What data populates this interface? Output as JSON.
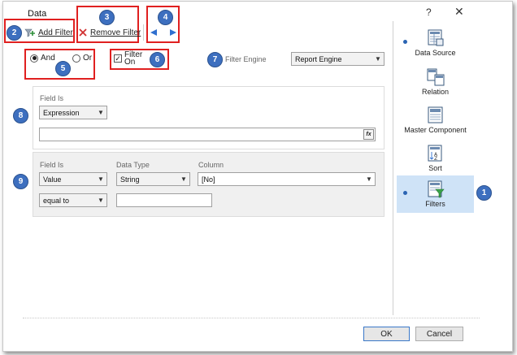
{
  "window": {
    "title": "Data",
    "help": "?",
    "close": "✕"
  },
  "toolbar": {
    "add_filter": "Add Filter",
    "remove_filter": "Remove Filter"
  },
  "callouts": [
    "1",
    "2",
    "3",
    "4",
    "5",
    "6",
    "7",
    "8",
    "9"
  ],
  "logic": {
    "and_label": "And",
    "or_label": "Or",
    "selected": "And"
  },
  "filter_on": {
    "label_line1": "Filter",
    "label_line2": "On",
    "checked": true
  },
  "filter_engine": {
    "label": "Filter Engine",
    "value": "Report Engine"
  },
  "filter1": {
    "field_is_label": "Field Is",
    "field_is_value": "Expression",
    "expression_value": ""
  },
  "filter2": {
    "field_is_label": "Field Is",
    "data_type_label": "Data Type",
    "column_label": "Column",
    "field_is_value": "Value",
    "data_type_value": "String",
    "column_value": "[No]",
    "condition_value": "equal to",
    "value_text": ""
  },
  "nav": {
    "items": [
      {
        "label": "Data Source",
        "selected": false,
        "dot": true
      },
      {
        "label": "Relation",
        "selected": false,
        "dot": false
      },
      {
        "label": "Master Component",
        "selected": false,
        "dot": false
      },
      {
        "label": "Sort",
        "selected": false,
        "dot": false
      },
      {
        "label": "Filters",
        "selected": true,
        "dot": true
      }
    ]
  },
  "buttons": {
    "ok": "OK",
    "cancel": "Cancel"
  },
  "colors": {
    "callout_red": "#e02020",
    "badge_blue": "#3d6fbf",
    "selected_nav": "#cfe3f7"
  }
}
